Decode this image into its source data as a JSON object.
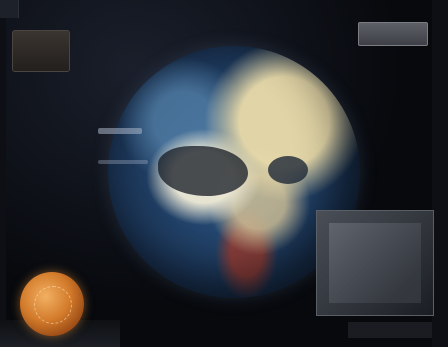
{
  "scene": {
    "title": "",
    "accent_color": "#d27a2a",
    "background_color": "#06070a"
  },
  "top_right_button": {
    "label": ""
  },
  "bottom_right_label": {
    "text": ""
  },
  "icons": {
    "globe": "globe-icon",
    "orb": "orb-icon"
  }
}
